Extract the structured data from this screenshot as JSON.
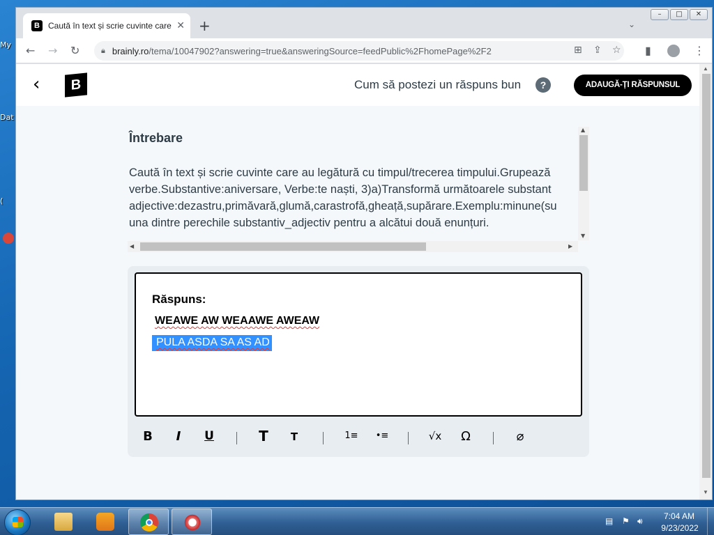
{
  "desktop": {
    "icons": [
      {
        "label": "My"
      },
      {
        "label": "Dat"
      },
      {
        "label": "("
      }
    ]
  },
  "browser": {
    "tab_title": "Caută în text și scrie cuvinte care au legătură cu timpul",
    "tab_close": "✕",
    "new_tab": "+",
    "tab_search_icon": "chevron-down-icon",
    "url_host": "brainly.ro",
    "url_path": "/tema/10047902?answering=true&answeringSource=feedPublic%2FhomePage%2F2",
    "window_controls": [
      "–",
      "□",
      "✕"
    ]
  },
  "site": {
    "logo": "B",
    "howto_link": "Cum să postezi un răspuns bun",
    "help_icon": "?",
    "add_answer_button": "ADAUGĂ-ȚI RĂSPUNSUL"
  },
  "question": {
    "heading": "Întrebare",
    "lines": [
      "Caută în text și scrie cuvinte care au legătură cu timpul/trecerea timpului.Grupează",
      "verbe.Substantive:aniversare, Verbe:te naști, 3)a)Transformă următoarele substant",
      "adjective:dezastru,primăvară,glumă,carastrofă,gheață,supărare.Exemplu:minune(su",
      "una dintre perechile substantiv_adjectiv pentru a alcătui două enunțuri."
    ]
  },
  "answer": {
    "label": "Răspuns:",
    "line1": "WEAWE AW WEAAWE AWEAW",
    "line2": "PULA ASDA SA AS AD"
  },
  "format_toolbar": {
    "bold": "B",
    "italic": "I",
    "underline": "U",
    "heading_large": "T",
    "heading_small": "T",
    "ordered_list": "1≡",
    "bullet_list": "•≡",
    "math": "√x",
    "symbol": "Ω",
    "attach": "⌀"
  },
  "taskbar": {
    "clock_time": "7:04 AM",
    "clock_date": "9/23/2022"
  },
  "colors": {
    "accent_black": "#000000",
    "selection_blue": "#3390ff",
    "spellcheck_red": "#e53935",
    "page_bg": "#f5f8fa",
    "card_bg": "#e8edf2"
  }
}
